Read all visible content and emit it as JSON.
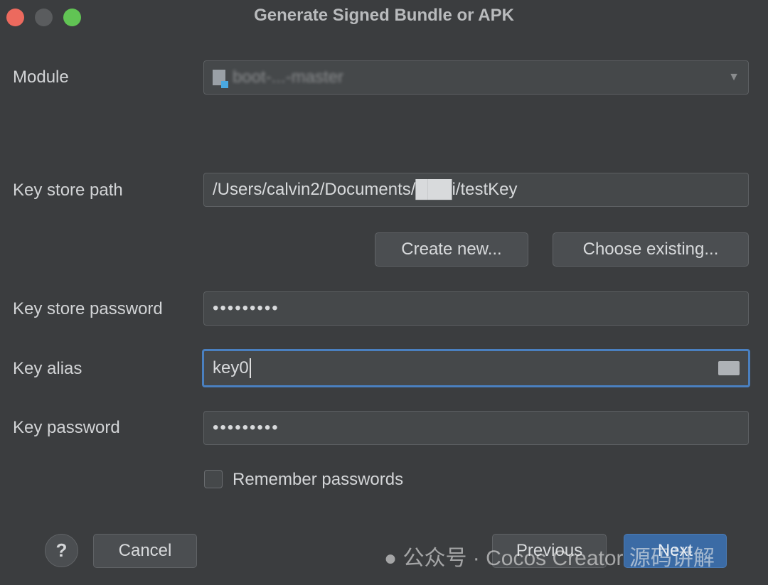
{
  "window": {
    "title": "Generate Signed Bundle or APK"
  },
  "colors": {
    "close": "#ec6a5e",
    "minimize": "#5a5c5e",
    "zoom": "#61c454",
    "accent": "#3b6ba5",
    "focus": "#4a80c0"
  },
  "module": {
    "label": "Module",
    "value": "boot-...-master"
  },
  "keystore_path": {
    "label": "Key store path",
    "value": "/Users/calvin2/Documents/███i/testKey"
  },
  "buttons": {
    "create_new": "Create new...",
    "choose_existing": "Choose existing...",
    "cancel": "Cancel",
    "previous": "Previous",
    "next": "Next",
    "help": "?"
  },
  "keystore_password": {
    "label": "Key store password",
    "value": "•••••••••"
  },
  "key_alias": {
    "label": "Key alias",
    "value": "key0"
  },
  "key_password": {
    "label": "Key password",
    "value": "•••••••••"
  },
  "remember": {
    "label": "Remember passwords",
    "checked": false
  },
  "watermark": "公众号 · Cocos Creator 源码讲解"
}
